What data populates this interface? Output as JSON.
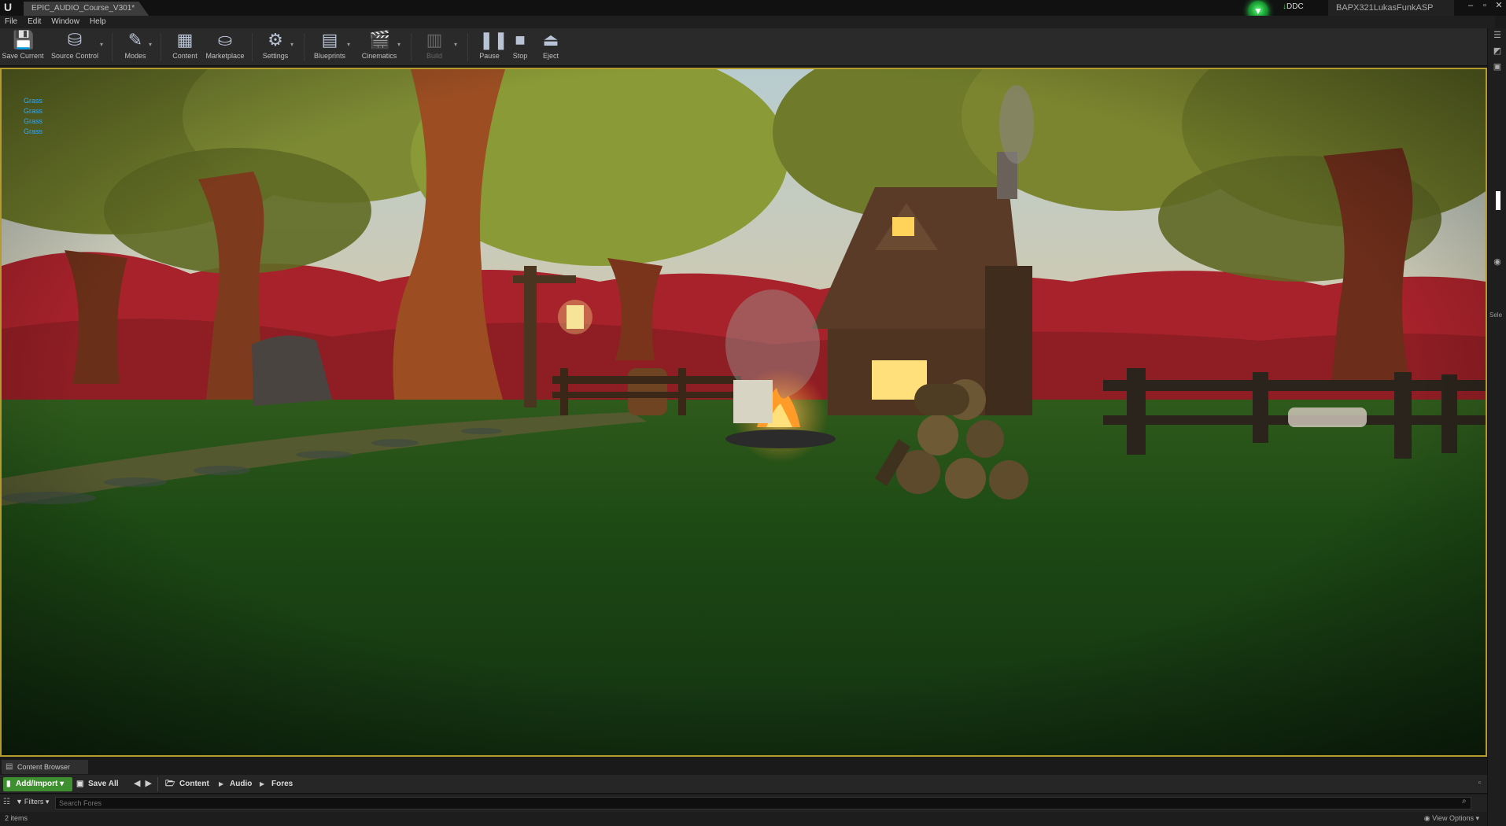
{
  "window": {
    "doc_tab": "EPIC_AUDIO_Course_V301*",
    "ddc_label": "DDC",
    "project_name": "BAPX321LukasFunkASP",
    "controls": [
      "–",
      "▫",
      "✕"
    ]
  },
  "menu": [
    "File",
    "Edit",
    "Window",
    "Help"
  ],
  "toolbar": [
    {
      "label": "Save Current",
      "icon": "save-icon"
    },
    {
      "label": "Source Control",
      "icon": "source-control-icon"
    },
    {
      "label": "Modes",
      "icon": "modes-icon"
    },
    {
      "label": "Content",
      "icon": "content-icon"
    },
    {
      "label": "Marketplace",
      "icon": "marketplace-icon"
    },
    {
      "label": "Settings",
      "icon": "settings-icon"
    },
    {
      "label": "Blueprints",
      "icon": "blueprints-icon"
    },
    {
      "label": "Cinematics",
      "icon": "cinematics-icon"
    },
    {
      "label": "Build",
      "icon": "build-icon",
      "disabled": true
    },
    {
      "label": "Pause",
      "icon": "pause-icon"
    },
    {
      "label": "Stop",
      "icon": "stop-icon"
    },
    {
      "label": "Eject",
      "icon": "eject-icon"
    }
  ],
  "viewport": {
    "stats": [
      "Grass",
      "Grass",
      "Grass",
      "Grass"
    ]
  },
  "content_browser": {
    "tab_label": "Content Browser",
    "add_import": "Add/Import",
    "save_all": "Save All",
    "breadcrumbs": [
      "Content",
      "Audio",
      "Fores"
    ],
    "filters": "Filters",
    "search_placeholder": "Search Fores",
    "items_count": "2 items",
    "view_options": "View Options"
  },
  "right_strip": {
    "label": "Sele"
  },
  "colors": {
    "accent_green": "#3d8f2f",
    "viewport_border": "#b59a2f",
    "stat_text": "#2aa8ff"
  }
}
